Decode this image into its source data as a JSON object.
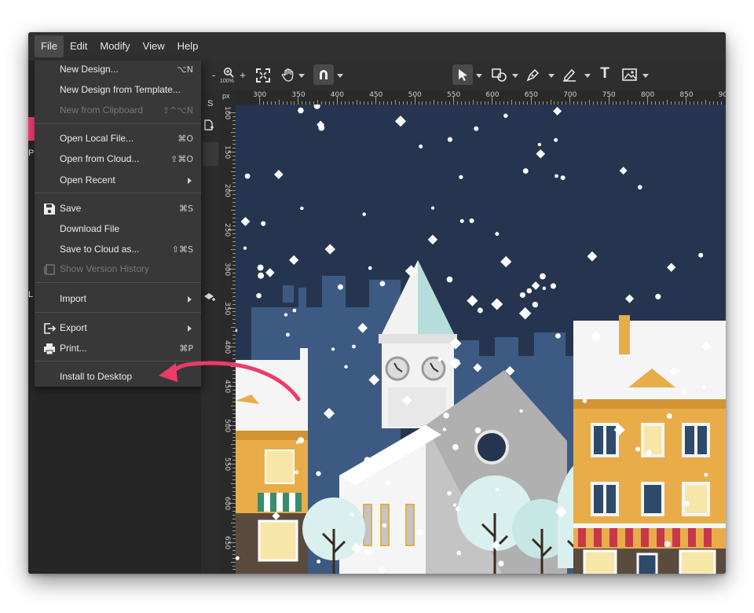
{
  "menubar": {
    "items": [
      {
        "label": "File"
      },
      {
        "label": "Edit"
      },
      {
        "label": "Modify"
      },
      {
        "label": "View"
      },
      {
        "label": "Help"
      }
    ]
  },
  "file_menu": {
    "items": [
      {
        "label": "New Design...",
        "shortcut": "⌥N",
        "enabled": true
      },
      {
        "label": "New Design from Template...",
        "shortcut": "",
        "enabled": true
      },
      {
        "label": "New from Clipboard",
        "shortcut": "⇧^⌥N",
        "enabled": false
      },
      {
        "label": "Open Local File...",
        "shortcut": "⌘O",
        "enabled": true
      },
      {
        "label": "Open from Cloud...",
        "shortcut": "⇧⌘O",
        "enabled": true
      },
      {
        "label": "Open Recent",
        "shortcut": "",
        "enabled": true,
        "submenu": true
      },
      {
        "label": "Save",
        "shortcut": "⌘S",
        "enabled": true,
        "icon": "save-icon"
      },
      {
        "label": "Download File",
        "shortcut": "",
        "enabled": true
      },
      {
        "label": "Save to Cloud as...",
        "shortcut": "⇧⌘S",
        "enabled": true
      },
      {
        "label": "Show Version History",
        "shortcut": "",
        "enabled": false,
        "icon": "history-icon"
      },
      {
        "label": "Import",
        "shortcut": "",
        "enabled": true,
        "submenu": true
      },
      {
        "label": "Export",
        "shortcut": "",
        "enabled": true,
        "submenu": true,
        "icon": "export-icon"
      },
      {
        "label": "Print...",
        "shortcut": "⌘P",
        "enabled": true,
        "icon": "print-icon"
      },
      {
        "label": "Install to Desktop",
        "shortcut": "",
        "enabled": true
      }
    ]
  },
  "toolbar": {
    "zoom_minus": "-",
    "zoom_plus": "+",
    "zoom_level": "100%",
    "text_tool": "T",
    "icons": [
      "zoom-icon",
      "fit-screen-icon",
      "hand-icon",
      "magnet-icon",
      "pointer-icon",
      "shapes-icon",
      "pen-icon",
      "pencil-icon",
      "text-icon",
      "image-icon"
    ]
  },
  "side_strip": {
    "letters": [
      "S",
      "P",
      "L"
    ]
  },
  "rulers": {
    "unit": "px",
    "top_labels": [
      "300",
      "350",
      "400",
      "450",
      "500",
      "550",
      "600",
      "650",
      "700",
      "750",
      "800",
      "850",
      "90"
    ],
    "left_labels": [
      "100",
      "150",
      "200",
      "250",
      "300",
      "350",
      "400",
      "450",
      "500",
      "550",
      "600",
      "650"
    ]
  },
  "colors": {
    "sky": "#26354f",
    "annotation_arrow": "#ee3a6a",
    "menu_bg": "#383838",
    "building_yellow": "#e8ad48"
  }
}
